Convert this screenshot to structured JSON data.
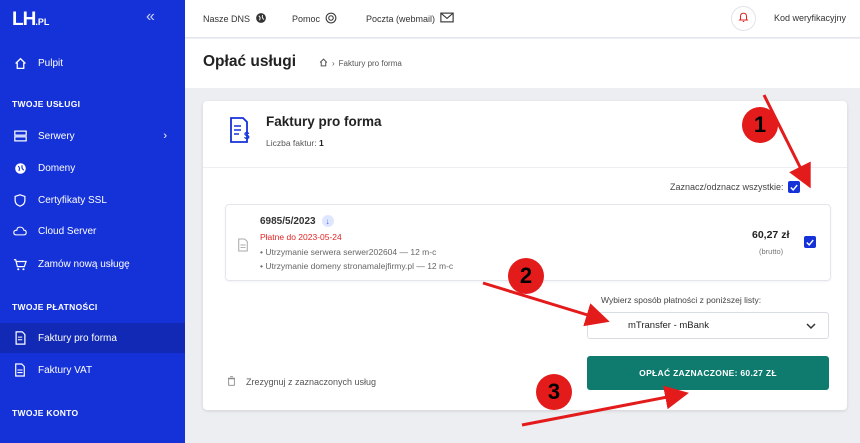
{
  "brand": {
    "logo": "LH",
    "logo_suffix": ".PL",
    "accent": "#1532d9",
    "button_color": "#0f7b6e",
    "annotation_color": "#e31b1b"
  },
  "sidebar": {
    "home": "Pulpit",
    "sections": [
      "TWOJE USŁUGI",
      "TWOJE PŁATNOŚCI",
      "TWOJE KONTO"
    ],
    "services": [
      {
        "label": "Serwery",
        "icon": "server-icon"
      },
      {
        "label": "Domeny",
        "icon": "globe-icon"
      },
      {
        "label": "Certyfikaty SSL",
        "icon": "shield-icon"
      },
      {
        "label": "Cloud Server",
        "icon": "cloud-icon"
      },
      {
        "label": "Zamów nową usługę",
        "icon": "cart-icon"
      }
    ],
    "payments": [
      {
        "label": "Faktury pro forma",
        "icon": "invoice-icon"
      },
      {
        "label": "Faktury VAT",
        "icon": "document-icon"
      }
    ]
  },
  "topbar": {
    "dns": "Nasze DNS",
    "help": "Pomoc",
    "mail": "Poczta (webmail)",
    "code": "Kod weryfikacyjny"
  },
  "header": {
    "title": "Opłać usługi",
    "breadcrumb": "Faktury pro forma"
  },
  "card": {
    "title": "Faktury pro forma",
    "count_label": "Liczba faktur:",
    "count": "1",
    "select_all": "Zaznacz/odznacz wszystkie:",
    "invoice": {
      "number": "6985/5/2023",
      "due": "Płatne do 2023-05-24",
      "lines": [
        "• Utrzymanie serwera serwer202604 — 12 m-c",
        "• Utrzymanie domeny stronamalejfirmy.pl — 12 m-c"
      ],
      "price": "60,27 zł",
      "price_note": "(brutto)"
    },
    "payment_label": "Wybierz sposób płatności z poniższej listy:",
    "payment_selected": "mTransfer - mBank",
    "cancel_label": "Zrezygnuj z zaznaczonych usług",
    "pay_button": "OPŁAĆ ZAZNACZONE: 60.27 ZŁ"
  },
  "annotations": [
    "1",
    "2",
    "3"
  ]
}
